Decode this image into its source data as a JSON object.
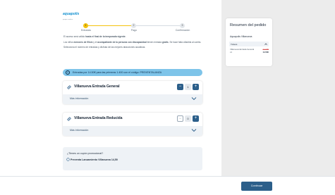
{
  "brand": {
    "name": "aquapolis",
    "tagline": "parque acuático",
    "accent": "#0f8fcf"
  },
  "stepper": {
    "steps": [
      {
        "number": "1",
        "label": "Entradas",
        "active": true
      },
      {
        "number": "2",
        "label": "Pago",
        "active": false
      },
      {
        "number": "3",
        "label": "Confirmación",
        "active": false
      }
    ]
  },
  "intro": {
    "p1_before": "El acceso será válido ",
    "p1_bold": "hasta el final de la temporada vigente",
    "p1_after": ".",
    "p2_before": "Los niños ",
    "p2_bold1": "menores de 90cm",
    "p2_mid": " y el ",
    "p2_bold2": "acompañante de la persona con discapacidad",
    "p2_mid2": " tienen entrada ",
    "p2_bold3": "gratis",
    "p2_after": ". Se hace falta añadirla al carrito.",
    "p3": "Selecciona el número de entradas y disfruta de las mejores atracciones acuáticas."
  },
  "promo": {
    "icon": "info-icon",
    "text": "Entradas por 14.50€ para las primeras 1.400 con el código: PREVENTALANZA",
    "color": "#7ec4e9"
  },
  "tickets": [
    {
      "title": "Villanueva Entrada General",
      "quantity": "1",
      "more_label": "Más información",
      "minus_enabled": true
    },
    {
      "title": "Villanueva Entrada Reducida",
      "quantity": "0",
      "more_label": "Más información",
      "minus_enabled": false
    }
  ],
  "coupon": {
    "question": "¿Tienes un cupón promocional?",
    "code": "Preventa Lanzamiento Villanueva 14,50"
  },
  "summary": {
    "title": "Resumen del pedido",
    "subtitle": "Aquapolis Villanueva",
    "tab_label": "Tickets",
    "item_name": "Villanueva Entrada General x1",
    "original_price": "22.00€",
    "final_price": "14.50€"
  },
  "footer": {
    "continue_label": "Continuar",
    "button_color": "#2c5f8a"
  }
}
